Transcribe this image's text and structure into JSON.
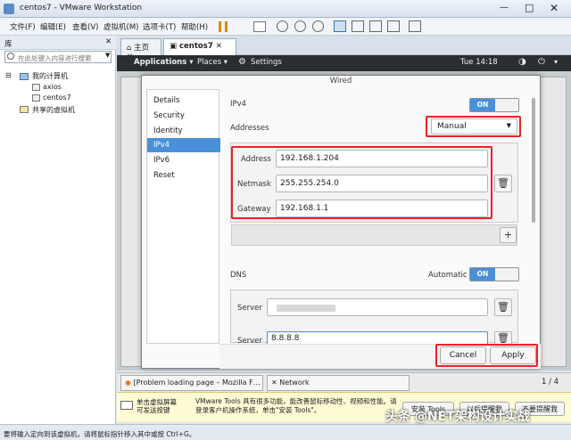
{
  "window": {
    "title": "centos7 - VMware Workstation"
  },
  "menu": [
    "文件(F)",
    "编辑(E)",
    "查看(V)",
    "虚拟机(M)",
    "选项卡(T)",
    "帮助(H)"
  ],
  "library": {
    "header": "库",
    "search_placeholder": "在此处键入内容进行搜索",
    "my_computer": "我的计算机",
    "vms": [
      "axios",
      "centos7"
    ],
    "shared": "共享的虚拟机"
  },
  "tabs": [
    "主页",
    "centos7"
  ],
  "gnome": {
    "applications": "Applications",
    "places": "Places",
    "settings": "Settings",
    "time": "Tue 14:18"
  },
  "dialog": {
    "title": "Wired",
    "sidebar": [
      "Details",
      "Security",
      "Identity",
      "IPv4",
      "IPv6",
      "Reset"
    ],
    "ipv4_label": "IPv4",
    "on_label": "ON",
    "addresses_label": "Addresses",
    "method": "Manual",
    "address_label": "Address",
    "address": "192.168.1.204",
    "netmask_label": "Netmask",
    "netmask": "255.255.254.0",
    "gateway_label": "Gateway",
    "gateway": "192.168.1.1",
    "dns_label": "DNS",
    "automatic_label": "Automatic",
    "server_label": "Server",
    "server2": "8.8.8.8",
    "cancel": "Cancel",
    "apply": "Apply"
  },
  "taskbar": {
    "item1": "[Problem loading page – Mozilla F…",
    "item2": "Network",
    "pager": "1 / 4"
  },
  "notice": {
    "left": "单击虚拟屏幕\n可发送按键",
    "text": "VMware Tools 具有很多功能，能改善鼠标移动性、视频和性能。请登录客户机操作系统，单击\"安装 Tools\"。",
    "install": "安装 Tools",
    "later": "以后提醒我",
    "never": "不要提醒我"
  },
  "status": "要将输入定向到该虚拟机，请将鼠标指针移入其中或按 Ctrl+G。",
  "watermark": "头条 @NET架构设计实战"
}
